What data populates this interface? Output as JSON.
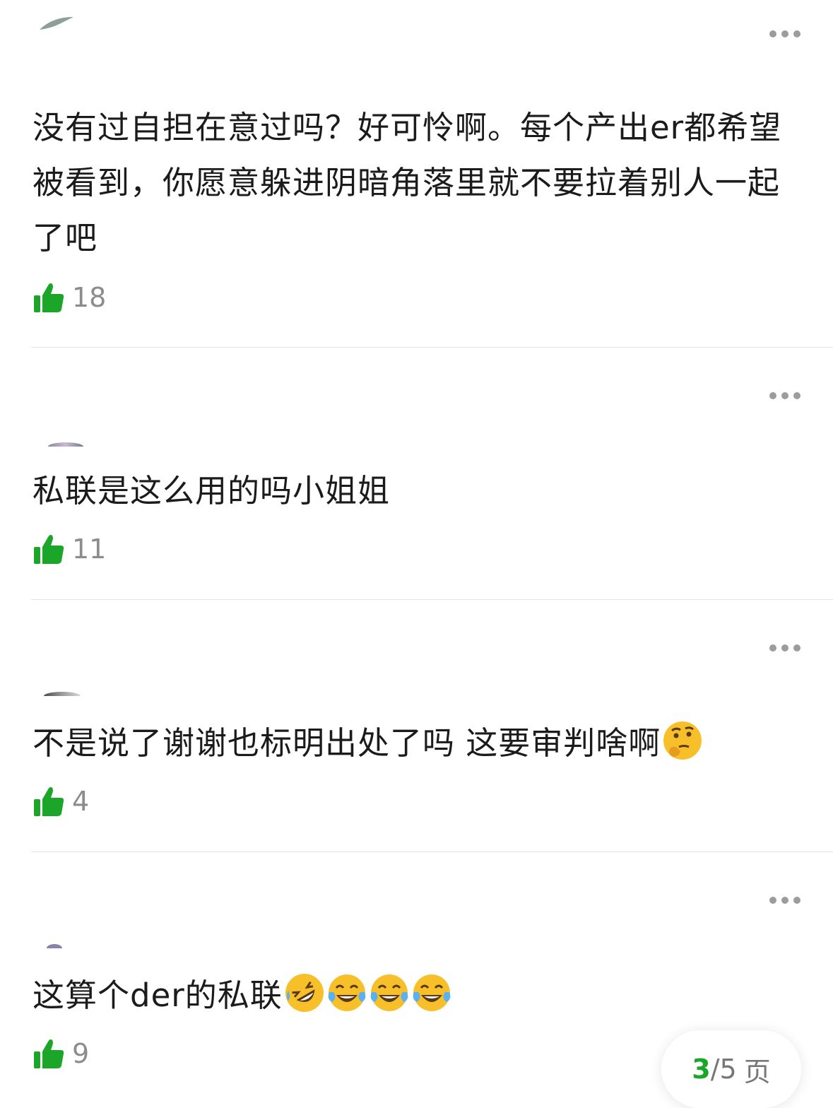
{
  "comments": [
    {
      "text": "没有过自担在意过吗？好可怜啊。每个产出er都希望被看到，你愿意躲进阴暗角落里就不要拉着别人一起了吧",
      "likes": "18",
      "emojis": []
    },
    {
      "text": "私联是这么用的吗小姐姐",
      "likes": "11",
      "emojis": []
    },
    {
      "text": "不是说了谢谢也标明出处了吗 这要审判啥啊",
      "likes": "4",
      "emojis": [
        "thinking-face-icon"
      ]
    },
    {
      "text": "这算个der的私联",
      "likes": "9",
      "emojis": [
        "rolling-laughing-icon",
        "tears-of-joy-icon",
        "tears-of-joy-icon",
        "tears-of-joy-icon"
      ]
    }
  ],
  "pager": {
    "current": "3",
    "separator": "/",
    "total": "5",
    "unit": "页"
  },
  "colors": {
    "like_green": "#1ba62a",
    "accent_green": "#1ba62a",
    "muted_text": "#8c8c8c"
  }
}
